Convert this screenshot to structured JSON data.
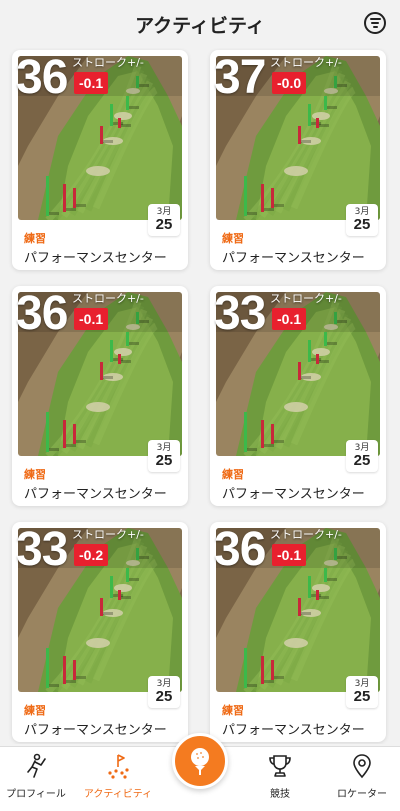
{
  "header": {
    "title": "アクティビティ",
    "menu_icon": "menu-circle-icon"
  },
  "colors": {
    "accent": "#f47b20",
    "badge": "#e8202e",
    "label": "#ef6a15"
  },
  "cards": [
    {
      "score": "36",
      "stroke_label": "ストローク+/-",
      "diff": "-0.1",
      "month": "3月",
      "day": "25",
      "type": "練習",
      "venue": "パフォーマンスセンター"
    },
    {
      "score": "37",
      "stroke_label": "ストローク+/-",
      "diff": "-0.0",
      "month": "3月",
      "day": "25",
      "type": "練習",
      "venue": "パフォーマンスセンター"
    },
    {
      "score": "36",
      "stroke_label": "ストローク+/-",
      "diff": "-0.1",
      "month": "3月",
      "day": "25",
      "type": "練習",
      "venue": "パフォーマンスセンター"
    },
    {
      "score": "33",
      "stroke_label": "ストローク+/-",
      "diff": "-0.1",
      "month": "3月",
      "day": "25",
      "type": "練習",
      "venue": "パフォーマンスセンター"
    },
    {
      "score": "33",
      "stroke_label": "ストローク+/-",
      "diff": "-0.2",
      "month": "3月",
      "day": "25",
      "type": "練習",
      "venue": "パフォーマンスセンター"
    },
    {
      "score": "36",
      "stroke_label": "ストローク+/-",
      "diff": "-0.1",
      "month": "3月",
      "day": "25",
      "type": "練習",
      "venue": "パフォーマンスセンター"
    }
  ],
  "nav": {
    "profile": {
      "label": "プロフィール",
      "icon": "golfer-icon"
    },
    "activity": {
      "label": "アクティビティ",
      "icon": "flag-range-icon"
    },
    "center": {
      "icon": "golf-ball-tee-icon"
    },
    "competition": {
      "label": "競技",
      "icon": "trophy-icon"
    },
    "locator": {
      "label": "ロケーター",
      "icon": "location-pin-icon"
    }
  }
}
